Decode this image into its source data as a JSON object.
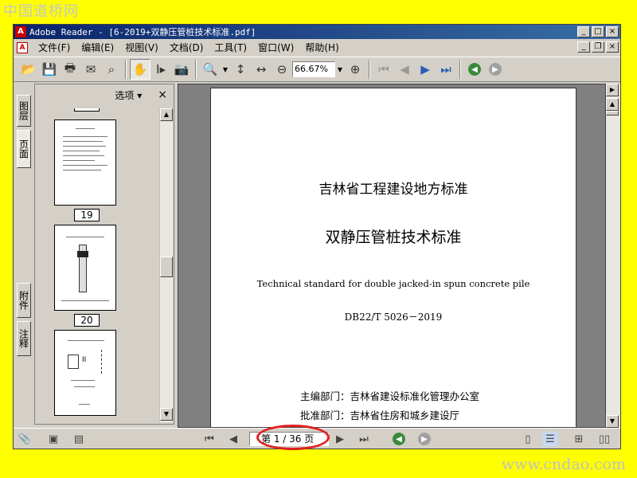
{
  "watermark": {
    "top": "中国道桥网",
    "bottom": "www.cndao.com"
  },
  "window": {
    "title": "Adobe Reader - [6-2019+双静压管桩技术标准.pdf]"
  },
  "menu": [
    "文件(F)",
    "编辑(E)",
    "视图(V)",
    "文档(D)",
    "工具(T)",
    "窗口(W)",
    "帮助(H)"
  ],
  "toolbar": {
    "zoom_value": "66.67%"
  },
  "side_tabs": [
    "图层",
    "页面",
    "附件",
    "注释"
  ],
  "panel": {
    "options_label": "选项",
    "close_label": "×"
  },
  "thumbnails": [
    {
      "label": "19"
    },
    {
      "label": "20"
    }
  ],
  "document": {
    "heading1": "吉林省工程建设地方标准",
    "heading2": "双静压管桩技术标准",
    "english_title": "Technical standard for double jacked-in spun concrete pile",
    "code": "DB22/T 5026－2019",
    "line1": "主编部门：吉林省建设标准化管理办公室",
    "line2": "批准部门：吉林省住房和城乡建设厅"
  },
  "status": {
    "page_indicator": "第 1 / 36 页"
  },
  "colors": {
    "accent": "#0a246a",
    "highlight": "#e02020",
    "background": "#ffff00"
  }
}
